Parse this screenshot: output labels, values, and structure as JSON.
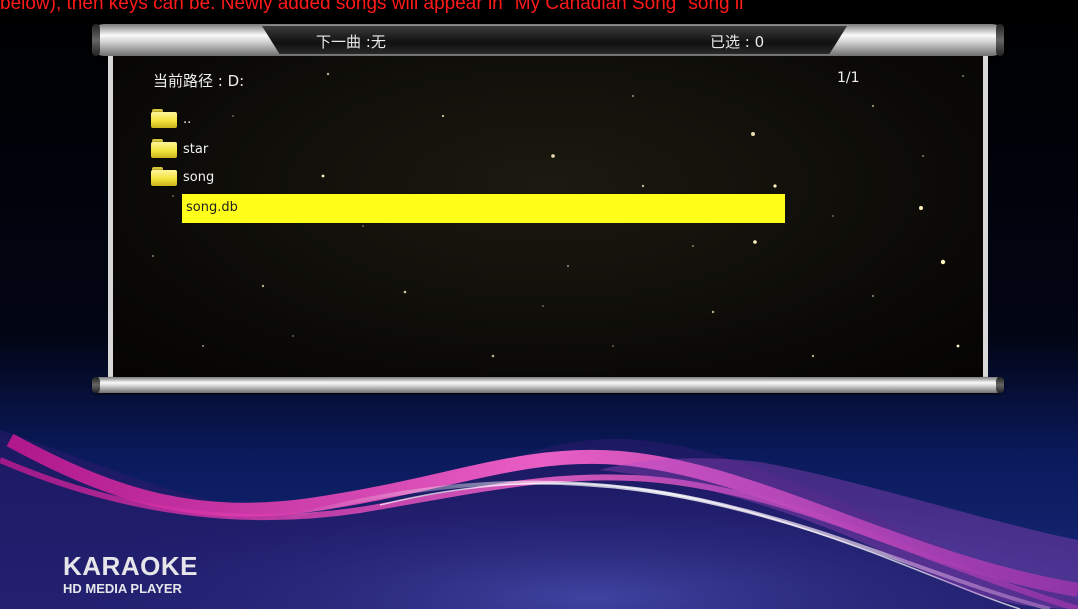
{
  "top_caption": "below), then keys can be. Newly added songs will appear in \"My Canadian Song\" song li",
  "header": {
    "next_song": "下一曲 :无",
    "selected": "已选 : 0"
  },
  "browser": {
    "current_path": "当前路径 : D:",
    "page": "1/1",
    "items": [
      {
        "name": "..",
        "icon": "folder-icon"
      },
      {
        "name": "star",
        "icon": "folder-icon"
      },
      {
        "name": "song",
        "icon": "folder-icon"
      },
      {
        "name": "song.db",
        "icon": "",
        "selected": true
      }
    ]
  },
  "brand": {
    "title": "KARAOKE",
    "subtitle": "HD MEDIA PLAYER"
  },
  "colors": {
    "caption": "#ff1a1a",
    "highlight": "#ffff1a",
    "folder": "#f2e23c"
  }
}
